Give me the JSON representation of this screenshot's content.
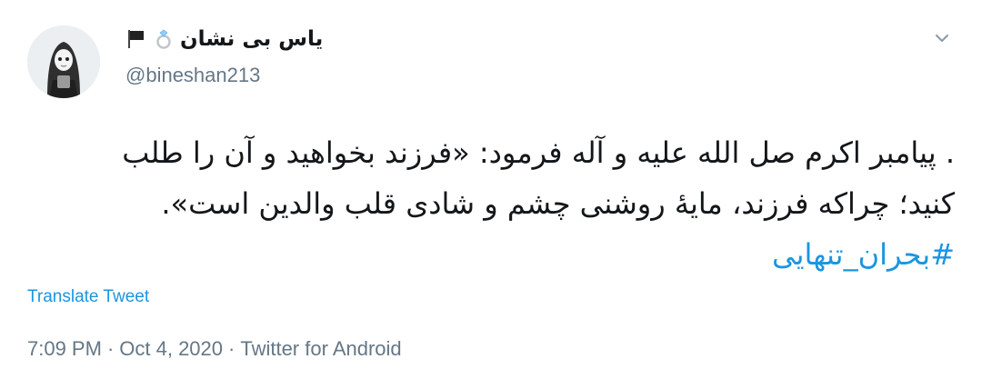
{
  "author": {
    "display_name": "یاس بی نشان",
    "handle": "@bineshan213",
    "name_emojis": [
      "ring-emoji",
      "black-flag-emoji"
    ],
    "avatar_icon": "avatar-girl-illustration"
  },
  "menu": {
    "icon": "chevron-down-icon"
  },
  "tweet": {
    "text_line1": ". پیامبر اکرم صل الله علیه و آله فرمود: «فرزند بخواهید و آن را طلب",
    "text_line2": "کنید؛ چراکه فرزند، مایهٔ روشنی چشم و شادی قلب والدین است».",
    "hashtag": "#بحران_تنهایی"
  },
  "translate_label": "Translate Tweet",
  "meta": {
    "time": "7:09 PM",
    "separator": "·",
    "date": "Oct 4, 2020",
    "source": "Twitter for Android"
  },
  "colors": {
    "link": "#1b95e0",
    "secondary": "#657786",
    "text": "#14171a"
  }
}
